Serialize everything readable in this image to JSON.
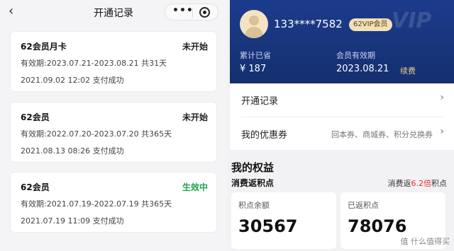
{
  "left": {
    "nav": {
      "back_icon": "chevron-left-icon",
      "title": "开通记录",
      "more_label": "•••",
      "close_icon": "target-close-icon"
    },
    "records": [
      {
        "name": "62会员月卡",
        "status": "未开始",
        "period": "有效期:2023.07.21-2023.08.21 共31天",
        "paid": "2021.09.02 12:02 支付成功"
      },
      {
        "name": "62会员",
        "status": "未开始",
        "period": "有效期:2022.07.20-2023.07.20 共365天",
        "paid": "2021.08.13 08:26 支付成功"
      },
      {
        "name": "62会员",
        "status": "生效中",
        "period": "有效期:2021.07.19-2022.07.19 共365天",
        "paid": "2021.07.19 11:09 支付成功"
      }
    ],
    "colors": {
      "active_status": "#1fa64a"
    }
  },
  "right": {
    "hero": {
      "phone": "133****7582",
      "badge": "62VIP会员",
      "watermark": "VIP",
      "saved_label": "累计已省",
      "saved_value": "¥ 187",
      "valid_label": "会员有效期",
      "valid_value": "2023.08.21",
      "renew_label": "续费",
      "colors": {
        "bg": "#1c3b8c",
        "badge_bg": "#f1e0b8"
      }
    },
    "menu": [
      {
        "label": "开通记录",
        "hint": "",
        "icon": "chevron-right-icon"
      },
      {
        "label": "我的优惠券",
        "hint": "回本券、商城券、积分兑换券",
        "icon": "chevron-right-icon"
      }
    ],
    "benefits": {
      "title": "我的权益",
      "sub_title": "消费返积点",
      "sub_right_prefix": "消费返",
      "sub_right_highlight": "6.2倍",
      "sub_right_suffix": "积点",
      "stats": [
        {
          "label": "积点余额",
          "value": "30567"
        },
        {
          "label": "已返积点",
          "value": "78076"
        }
      ],
      "highlight_color": "#e0302f"
    },
    "watermark": "值 什么值得买"
  }
}
